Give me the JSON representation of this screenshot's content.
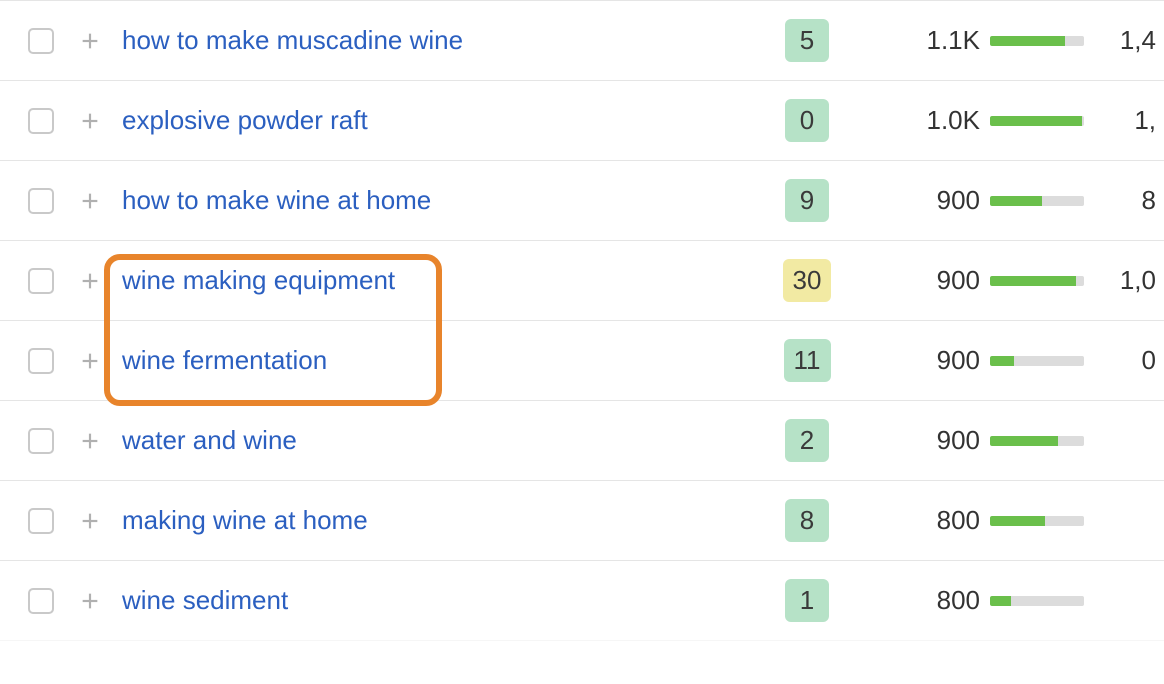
{
  "rows": [
    {
      "keyword": "how to make muscadine wine",
      "kd": "5",
      "kd_class": "kd-green",
      "volume": "1.1K",
      "bar_pct": 80,
      "extra": "1,4"
    },
    {
      "keyword": "explosive powder raft",
      "kd": "0",
      "kd_class": "kd-green",
      "volume": "1.0K",
      "bar_pct": 98,
      "extra": "1,"
    },
    {
      "keyword": "how to make wine at home",
      "kd": "9",
      "kd_class": "kd-green",
      "volume": "900",
      "bar_pct": 55,
      "extra": "8"
    },
    {
      "keyword": "wine making equipment",
      "kd": "30",
      "kd_class": "kd-yellow",
      "volume": "900",
      "bar_pct": 92,
      "extra": "1,0"
    },
    {
      "keyword": "wine fermentation",
      "kd": "11",
      "kd_class": "kd-green",
      "volume": "900",
      "bar_pct": 25,
      "extra": "0"
    },
    {
      "keyword": "water and wine",
      "kd": "2",
      "kd_class": "kd-green",
      "volume": "900",
      "bar_pct": 72,
      "extra": ""
    },
    {
      "keyword": "making wine at home",
      "kd": "8",
      "kd_class": "kd-green",
      "volume": "800",
      "bar_pct": 58,
      "extra": ""
    },
    {
      "keyword": "wine sediment",
      "kd": "1",
      "kd_class": "kd-green",
      "volume": "800",
      "bar_pct": 22,
      "extra": ""
    },
    {
      "keyword": "",
      "kd": "",
      "kd_class": "kd-yellow",
      "volume": "",
      "bar_pct": 0,
      "extra": ""
    }
  ],
  "colors": {
    "link": "#2b5fc0",
    "highlight": "#e8842b",
    "bar_fill": "#6abf4b",
    "bar_track": "#dcdcdc"
  }
}
